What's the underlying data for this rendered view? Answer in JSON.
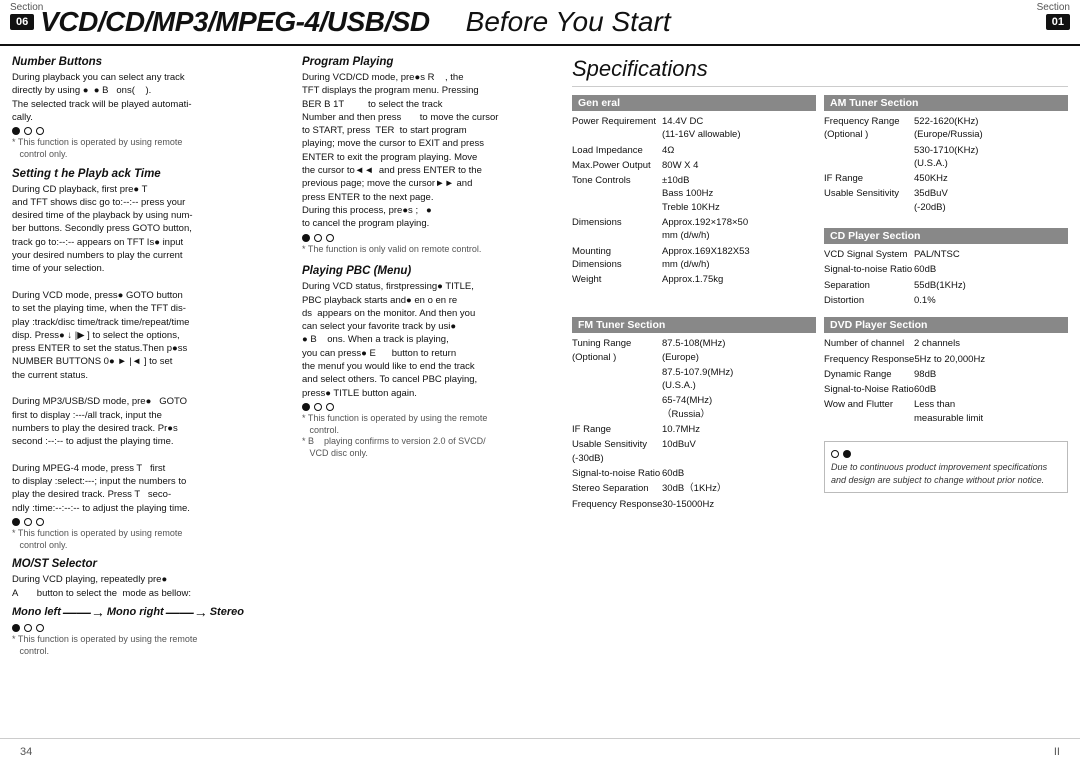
{
  "header": {
    "section_label_left": "Section",
    "section_num_left": "06",
    "title": "VCD/CD/MP3/MPEG-4/USB/SD",
    "subtitle": "Before You Start",
    "section_label_right": "Section",
    "section_num_right": "01"
  },
  "left_col": {
    "sections": [
      {
        "id": "number-buttons",
        "title": "Number Buttons",
        "body": "During playback you can select any track directly by using  ●  ●  B  ons(   ).\nThe selected track will be played automatically."
      },
      {
        "id": "setting-playback",
        "title": "Setting t he Playback Time",
        "body": "During CD playback, first pre● T and TFT shows disc go to:--:-- press your desired time of the playback by using number buttons. Secondly press GOTO button, track go to:--:-- appears on TFT Is● input your desired numbers to play the current time of your selection.\n\nDuring VCD mode, press● GOTO button to set the playing time, when the TFT display :track/disc time/track time/repeat/time disp. Press●  ↓  |▶  ] to select the options, press ENTER to set the status.Then p●ss NUMBER BUTTONS 0●  ►  |◄  ] to set the current status.\n\nDuring MP3/USB/SD mode, pre● GOTO first to display :---/all track, input the numbers to play the desired track. Pr●s second :--:-- to adjust the playing time.\n\nDuring MPEG-4 mode, press T  first to display :select:---; input the numbers to play the desired track. Press T  secondly :time:--:--:-- to adjust the playing time."
      },
      {
        "id": "most-selector",
        "title": "MO/ST Selector",
        "body": "During VCD playing, repeatedly pre●\nA      button to select the mode as bellow:"
      },
      {
        "id": "mono-diagram",
        "text": "Mono left ——→ Mono right ——→ Stereo"
      }
    ],
    "note": "* This function is operated by using the remote control."
  },
  "mid_col": {
    "sections": [
      {
        "id": "program-playing",
        "title": "Program Playing",
        "body": "During VCD/CD mode, pre●s R     , the TFT displays the program menu. Pressing BER B 1T      to select the track Number and then press       to move the cursor to START, press  TER  to start program playing; move the cursor to EXIT and press ENTER to exit the program playing. Move the cursor to◄◄  and press ENTER to the previous page; move the cursor►► and press ENTER to the next page.\nDuring this process, pre●s ;   ●\nto cancel the program playing."
      },
      {
        "id": "playing-pbc",
        "title": "Playing PBC (Menu)",
        "body": "During VCD status, firstpressing● TITLE, PBC playback starts and● en o en re ds  appears on the monitor. And then you can select your favorite track by usi●\n●  B   ons. When a track is playing, you can press●  E     button to return the menuf you would like to end the track and select others. To cancel PBC playing, press● TITLE button again."
      }
    ],
    "notes": [
      "* This function is only valid on remote control.",
      "* This function is operated by using the remote control.",
      "* B    playing confirms to version 2.0 of SVCD/VCD disc only."
    ]
  },
  "right_col": {
    "title": "Specifications",
    "sections": [
      {
        "id": "general",
        "header": "General",
        "rows": [
          {
            "label": "Power Requirement",
            "value": "14.4V DC\n(11-16V allowable)"
          },
          {
            "label": "Load Impedance",
            "value": "4Ω"
          },
          {
            "label": "Max.Power Output",
            "value": "80W X 4"
          },
          {
            "label": "Tone Controls",
            "value": "±10dB\nBass 100Hz\nTreble 10KHz"
          },
          {
            "label": "Dimensions",
            "value": "Approx.192×178×50\nmm (d/w/h)"
          },
          {
            "label": "Mounting\nDimensions",
            "value": "Approx.169X182X53\nmm (d/w/h)"
          },
          {
            "label": "Weight",
            "value": "Approx.1.75kg"
          }
        ]
      },
      {
        "id": "am-tuner",
        "header": "AM Tuner Section",
        "rows": [
          {
            "label": "Frequency Range\n(Optional )",
            "value": "522-1620(KHz)\n(Europe/Russia)"
          },
          {
            "label": "",
            "value": "530-1710(KHz)\n(U.S.A.)"
          },
          {
            "label": "IF Range",
            "value": "450KHz"
          },
          {
            "label": "Usable Sensitivity",
            "value": "35dBuV\n(-20dB)"
          }
        ]
      },
      {
        "id": "fm-tuner",
        "header": "FM Tuner Section",
        "rows": [
          {
            "label": "Tuning Range\n(Optional )",
            "value": "87.5-108(MHz)\n(Europe)"
          },
          {
            "label": "",
            "value": "87.5-107.9(MHz)\n(U.S.A.)"
          },
          {
            "label": "",
            "value": "65-74(MHz)\n（Russia）"
          },
          {
            "label": "IF Range",
            "value": "10.7MHz"
          },
          {
            "label": "Usable Sensitivity\n(-30dB)",
            "value": "10dBuV"
          },
          {
            "label": "Signal-to-noise Ratio",
            "value": "60dB"
          },
          {
            "label": "Stereo Separation",
            "value": "30dB（1KHz）"
          },
          {
            "label": "Frequency Response",
            "value": "30-15000Hz"
          }
        ]
      },
      {
        "id": "cd-player",
        "header": "CD Player Section",
        "rows": [
          {
            "label": "VCD Signal System",
            "value": "PAL/NTSC"
          },
          {
            "label": "Signal-to-noise Ratio",
            "value": "60dB"
          },
          {
            "label": "Separation",
            "value": "55dB(1KHz)"
          },
          {
            "label": "Distortion",
            "value": "0.1%"
          }
        ]
      },
      {
        "id": "dvd-player",
        "header": "DVD Player Section",
        "rows": [
          {
            "label": "Number of channel",
            "value": "2 channels"
          },
          {
            "label": "Frequency Response",
            "value": "5Hz to 20,000Hz"
          },
          {
            "label": "Dynamic Range",
            "value": "98dB"
          },
          {
            "label": "Signal-to-Noise Ratio",
            "value": "60dB"
          },
          {
            "label": "Wow and Flutter",
            "value": "Less than\nmeasurable limit"
          }
        ]
      }
    ],
    "notice": {
      "bullet": "○ ●",
      "text": "Due to continuous product improvement specifications and design are subject to change without prior notice."
    }
  },
  "footer": {
    "page_left": "34",
    "page_right": "II"
  }
}
